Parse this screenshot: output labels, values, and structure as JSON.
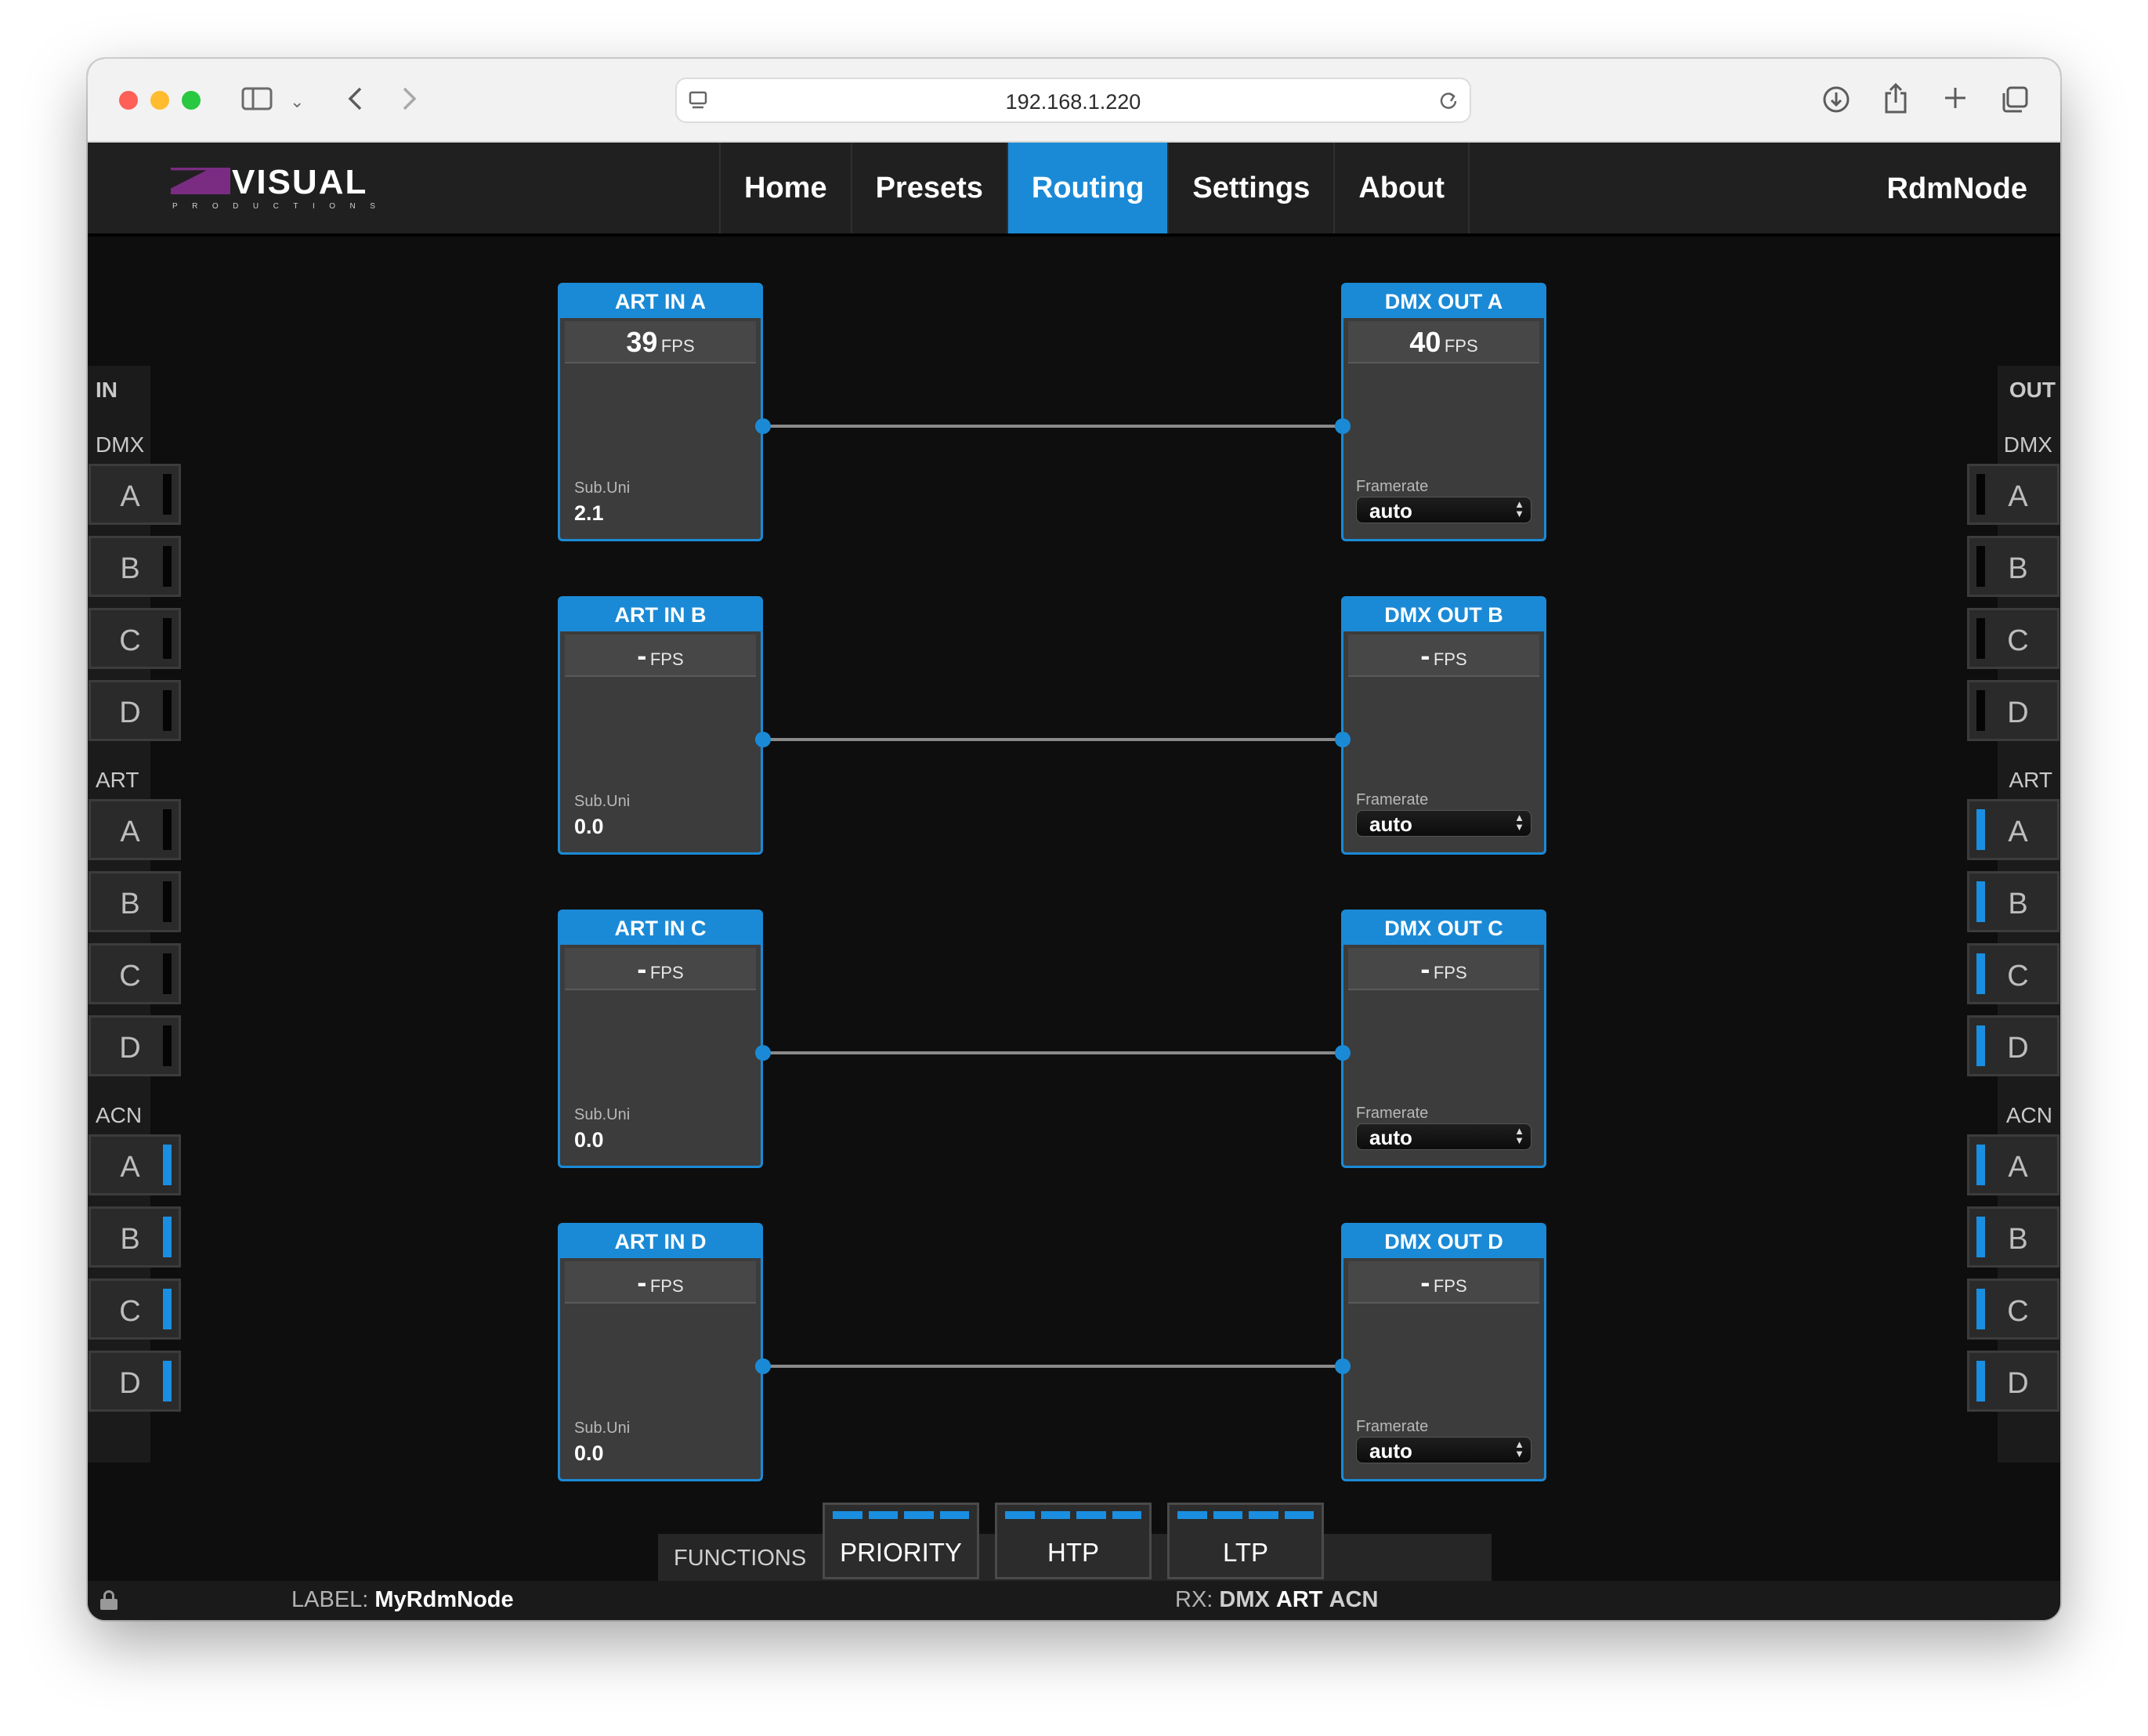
{
  "browser": {
    "url": "192.168.1.220"
  },
  "header": {
    "logo_text": "VISUAL",
    "logo_sub": "PRODUCTIONS",
    "nav": [
      {
        "label": "Home"
      },
      {
        "label": "Presets"
      },
      {
        "label": "Routing",
        "active": true
      },
      {
        "label": "Settings"
      },
      {
        "label": "About"
      }
    ],
    "device_name": "RdmNode"
  },
  "left_panel": {
    "title": "IN",
    "sections": [
      {
        "label": "DMX",
        "channels": [
          {
            "label": "A",
            "active": false
          },
          {
            "label": "B",
            "active": false
          },
          {
            "label": "C",
            "active": false
          },
          {
            "label": "D",
            "active": false
          }
        ]
      },
      {
        "label": "ART",
        "channels": [
          {
            "label": "A",
            "active": false
          },
          {
            "label": "B",
            "active": false
          },
          {
            "label": "C",
            "active": false
          },
          {
            "label": "D",
            "active": false
          }
        ]
      },
      {
        "label": "ACN",
        "channels": [
          {
            "label": "A",
            "active": true
          },
          {
            "label": "B",
            "active": true
          },
          {
            "label": "C",
            "active": true
          },
          {
            "label": "D",
            "active": true
          }
        ]
      }
    ]
  },
  "right_panel": {
    "title": "OUT",
    "sections": [
      {
        "label": "DMX",
        "channels": [
          {
            "label": "A",
            "active": false
          },
          {
            "label": "B",
            "active": false
          },
          {
            "label": "C",
            "active": false
          },
          {
            "label": "D",
            "active": false
          }
        ]
      },
      {
        "label": "ART",
        "channels": [
          {
            "label": "A",
            "active": true
          },
          {
            "label": "B",
            "active": true
          },
          {
            "label": "C",
            "active": true
          },
          {
            "label": "D",
            "active": true
          }
        ]
      },
      {
        "label": "ACN",
        "channels": [
          {
            "label": "A",
            "active": true
          },
          {
            "label": "B",
            "active": true
          },
          {
            "label": "C",
            "active": true
          },
          {
            "label": "D",
            "active": true
          }
        ]
      }
    ]
  },
  "routes": [
    {
      "input": {
        "title": "ART IN A",
        "fps": "39",
        "fps_unit": "FPS",
        "subuni_label": "Sub.Uni",
        "subuni": "2.1"
      },
      "output": {
        "title": "DMX OUT A",
        "fps": "40",
        "fps_unit": "FPS",
        "framerate_label": "Framerate",
        "framerate": "auto"
      }
    },
    {
      "input": {
        "title": "ART IN B",
        "fps": "-",
        "fps_unit": "FPS",
        "subuni_label": "Sub.Uni",
        "subuni": "0.0"
      },
      "output": {
        "title": "DMX OUT B",
        "fps": "-",
        "fps_unit": "FPS",
        "framerate_label": "Framerate",
        "framerate": "auto"
      }
    },
    {
      "input": {
        "title": "ART IN C",
        "fps": "-",
        "fps_unit": "FPS",
        "subuni_label": "Sub.Uni",
        "subuni": "0.0"
      },
      "output": {
        "title": "DMX OUT C",
        "fps": "-",
        "fps_unit": "FPS",
        "framerate_label": "Framerate",
        "framerate": "auto"
      }
    },
    {
      "input": {
        "title": "ART IN D",
        "fps": "-",
        "fps_unit": "FPS",
        "subuni_label": "Sub.Uni",
        "subuni": "0.0"
      },
      "output": {
        "title": "DMX OUT D",
        "fps": "-",
        "fps_unit": "FPS",
        "framerate_label": "Framerate",
        "framerate": "auto"
      }
    }
  ],
  "functions": {
    "label": "FUNCTIONS",
    "buttons": [
      {
        "label": "PRIORITY"
      },
      {
        "label": "HTP"
      },
      {
        "label": "LTP"
      }
    ]
  },
  "status": {
    "label_key": "LABEL:",
    "label_value": "MyRdmNode",
    "rx_key": "RX:",
    "rx_items": [
      "DMX",
      "ART",
      "ACN"
    ]
  },
  "colors": {
    "accent": "#1b8ad6",
    "background": "#0e0e0e",
    "indicator_on": "#1a8ee0"
  }
}
